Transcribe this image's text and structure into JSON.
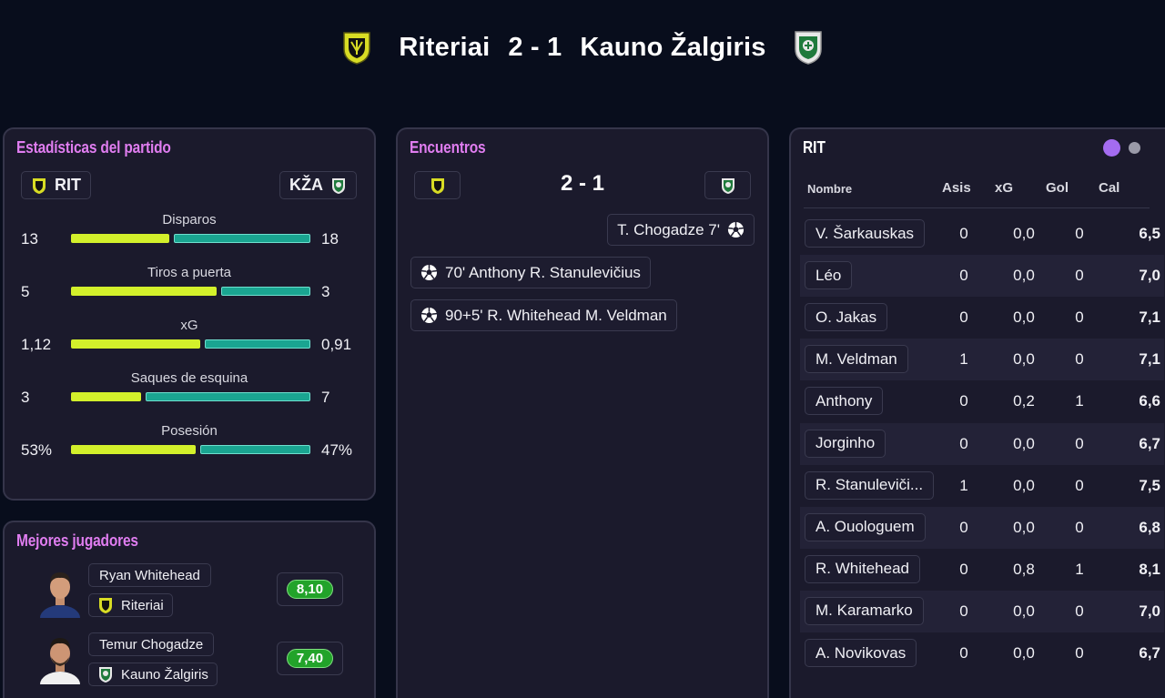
{
  "header": {
    "home_team": "Riteriai",
    "score": "2 - 1",
    "away_team": "Kauno Žalgiris"
  },
  "stats": {
    "title": "Estadísticas del partido",
    "home_abbr": "RIT",
    "away_abbr": "KŽA",
    "rows": [
      {
        "label": "Disparos",
        "home": "13",
        "away": "18",
        "home_share": 0.42
      },
      {
        "label": "Tiros a puerta",
        "home": "5",
        "away": "3",
        "home_share": 0.62
      },
      {
        "label": "xG",
        "home": "1,12",
        "away": "0,91",
        "home_share": 0.55
      },
      {
        "label": "Saques de esquina",
        "home": "3",
        "away": "7",
        "home_share": 0.3
      },
      {
        "label": "Posesión",
        "home": "53%",
        "away": "47%",
        "home_share": 0.53
      }
    ]
  },
  "best_players": {
    "title": "Mejores jugadores",
    "players": [
      {
        "name": "Ryan Whitehead",
        "team": "Riteriai",
        "rating": "8,10"
      },
      {
        "name": "Temur Chogadze",
        "team": "Kauno Žalgiris",
        "rating": "7,40"
      }
    ]
  },
  "events": {
    "title": "Encuentros",
    "score": "2 - 1",
    "away_goals": [
      {
        "text": "T. Chogadze 7'",
        "icon": "football-icon"
      }
    ],
    "home_goals": [
      {
        "text": "70' Anthony R. Stanulevičius",
        "icon": "football-icon"
      },
      {
        "text": "90+5' R. Whitehead M. Veldman",
        "icon": "football-icon"
      }
    ]
  },
  "lineup": {
    "team": "RIT",
    "columns": {
      "name": "Nombre",
      "assists": "Asis",
      "xg": "xG",
      "goals": "Gol",
      "rating": "Cal"
    },
    "players": [
      {
        "name": "V. Šarkauskas",
        "assists": "0",
        "xg": "0,0",
        "goals": "0",
        "rating": "6,5"
      },
      {
        "name": "Léo",
        "assists": "0",
        "xg": "0,0",
        "goals": "0",
        "rating": "7,0"
      },
      {
        "name": "O. Jakas",
        "assists": "0",
        "xg": "0,0",
        "goals": "0",
        "rating": "7,1"
      },
      {
        "name": "M. Veldman",
        "assists": "1",
        "xg": "0,0",
        "goals": "0",
        "rating": "7,1"
      },
      {
        "name": "Anthony",
        "assists": "0",
        "xg": "0,2",
        "goals": "1",
        "rating": "6,6"
      },
      {
        "name": "Jorginho",
        "assists": "0",
        "xg": "0,0",
        "goals": "0",
        "rating": "6,7"
      },
      {
        "name": "R. Stanuleviči...",
        "assists": "1",
        "xg": "0,0",
        "goals": "0",
        "rating": "7,5"
      },
      {
        "name": "A. Ouologuem",
        "assists": "0",
        "xg": "0,0",
        "goals": "0",
        "rating": "6,8"
      },
      {
        "name": "R. Whitehead",
        "assists": "0",
        "xg": "0,8",
        "goals": "1",
        "rating": "8,1"
      },
      {
        "name": "M. Karamarko",
        "assists": "0",
        "xg": "0,0",
        "goals": "0",
        "rating": "7,0"
      },
      {
        "name": "A. Novikovas",
        "assists": "0",
        "xg": "0,0",
        "goals": "0",
        "rating": "6,7"
      }
    ]
  },
  "colors": {
    "accent_title": "#e07df0",
    "home_bar": "#d3f02b",
    "away_bar": "#1aa591",
    "rating_good": "#22a32a"
  }
}
